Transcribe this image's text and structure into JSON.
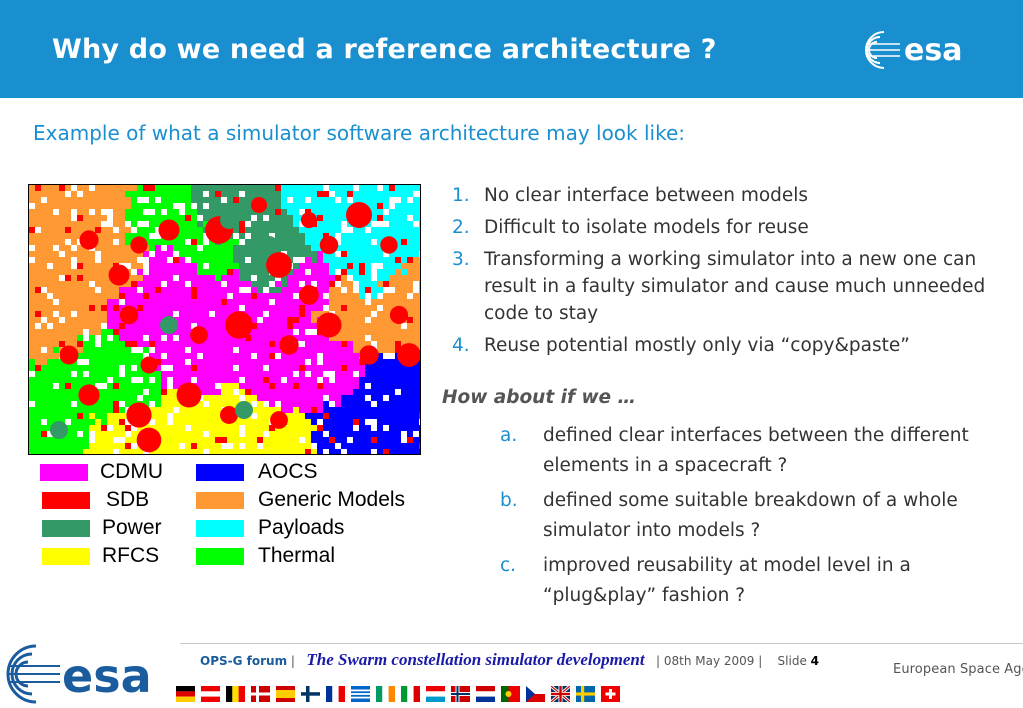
{
  "header": {
    "title": "Why do we need a reference architecture ?",
    "logo_text": "esa",
    "color": "#1a8fd0"
  },
  "subtitle": "Example of what a simulator software architecture may look like:",
  "legend": [
    {
      "label": "CDMU",
      "color": "#ff00ff"
    },
    {
      "label": "SDB",
      "color": "#ff0000"
    },
    {
      "label": "Power",
      "color": "#339966"
    },
    {
      "label": "RFCS",
      "color": "#ffff00"
    },
    {
      "label": "AOCS",
      "color": "#0000ff"
    },
    {
      "label": "Generic Models",
      "color": "#ff9933"
    },
    {
      "label": "Payloads",
      "color": "#00ffff"
    },
    {
      "label": "Thermal",
      "color": "#00ff00"
    }
  ],
  "problems": [
    {
      "num": "1.",
      "text": "No clear interface between models"
    },
    {
      "num": "2.",
      "text": "Difficult to isolate models for reuse"
    },
    {
      "num": "3.",
      "text": "Transforming a working simulator into a new one can result in a faulty simulator and cause much unneeded code to stay"
    },
    {
      "num": "4.",
      "text": "Reuse potential mostly only via “copy&paste”"
    }
  ],
  "how_about": "How about if we …",
  "proposals": [
    {
      "num": "a.",
      "text": "defined clear interfaces between the different elements in a spacecraft ?"
    },
    {
      "num": "b.",
      "text": "defined some suitable breakdown of a whole simulator into models ?"
    },
    {
      "num": "c.",
      "text": "improved reusability at model level in a “plug&play” fashion ?"
    }
  ],
  "footer": {
    "forum": "OPS-G forum",
    "sep1": "|",
    "presentation": "The Swarm constellation simulator development",
    "date": "| 08th May 2009 |",
    "slide_label": "Slide",
    "slide_number": "4",
    "agency": "European Space Agency",
    "logo_text": "esa"
  },
  "flags": [
    "germany-flag",
    "austria-flag",
    "belgium-flag",
    "denmark-flag",
    "spain-flag",
    "finland-flag",
    "france-flag",
    "greece-flag",
    "ireland-flag",
    "italy-flag",
    "luxembourg-flag",
    "norway-flag",
    "netherlands-flag",
    "portugal-flag",
    "czech-flag",
    "uk-flag",
    "sweden-flag",
    "switzerland-flag"
  ]
}
